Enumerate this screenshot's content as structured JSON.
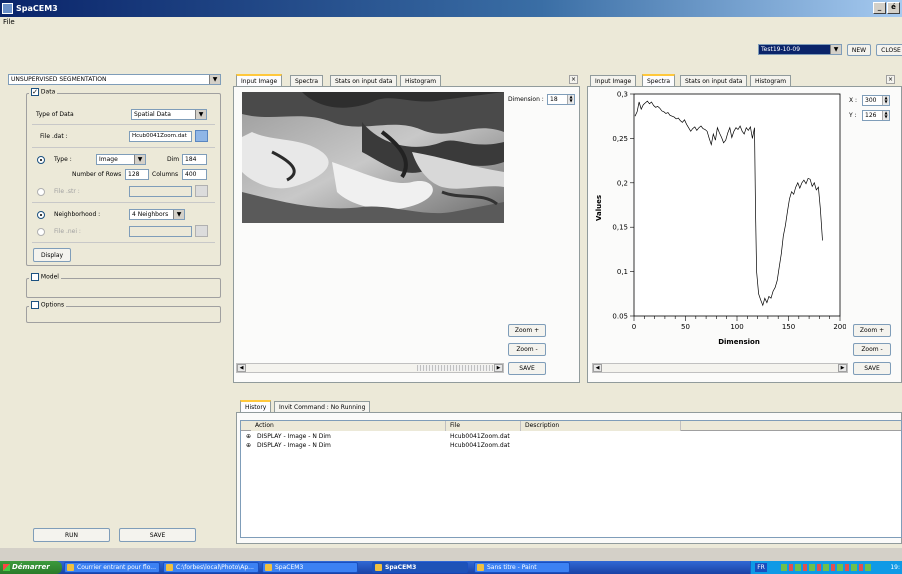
{
  "window": {
    "title": "SpaCEM3",
    "minimize": "_",
    "restore": "é"
  },
  "menu": {
    "file": "File"
  },
  "toolbar": {
    "session_value": "Test19-10-09",
    "new_label": "NEW",
    "close_label": "CLOSE"
  },
  "left": {
    "method_value": "UNSUPERVISED SEGMENTATION",
    "data_group": "Data",
    "type_of_data_label": "Type of Data",
    "type_of_data_value": "Spatial Data",
    "file_dat_label": "File .dat :",
    "file_dat_value": "Hcub0041Zoom.dat",
    "type_label": "Type :",
    "type_value": "Image",
    "dim_label": "Dim",
    "dim_value": "184",
    "rows_label": "Number of Rows",
    "rows_value": "128",
    "cols_label": "Columns",
    "cols_value": "400",
    "file_str_label": "File .str :",
    "neighborhood_label": "Neighborhood :",
    "neighborhood_value": "4 Neighbors",
    "file_nei_label": "File .nei :",
    "display_label": "Display",
    "model_group": "Model",
    "options_group": "Options",
    "run_label": "RUN",
    "save_label": "SAVE"
  },
  "left_view": {
    "tabs": [
      "Input Image",
      "Spectra",
      "Stats on input data",
      "Histogram"
    ],
    "dimension_label": "Dimension :",
    "dimension_value": "18",
    "zoom_in": "Zoom +",
    "zoom_out": "Zoom -",
    "save": "SAVE"
  },
  "right_view": {
    "tabs": [
      "Input Image",
      "Spectra",
      "Stats on input data",
      "Histogram"
    ],
    "x_label": "X :",
    "x_value": "300",
    "y_label": "Y :",
    "y_value": "126",
    "zoom_in": "Zoom +",
    "zoom_out": "Zoom -",
    "save": "SAVE"
  },
  "chart_data": {
    "type": "line",
    "xlabel": "Dimension",
    "ylabel": "Values",
    "xlim": [
      0,
      200
    ],
    "ylim": [
      0.05,
      0.3
    ],
    "x_ticks": [
      "0",
      "50",
      "100",
      "150",
      "200"
    ],
    "y_ticks": [
      "0,3",
      "0,25",
      "0,2",
      "0,15",
      "0,1",
      "0.05"
    ],
    "x": [
      1,
      3,
      5,
      7,
      9,
      11,
      13,
      15,
      17,
      19,
      21,
      23,
      25,
      27,
      29,
      31,
      33,
      35,
      37,
      39,
      41,
      43,
      45,
      47,
      49,
      51,
      53,
      55,
      57,
      59,
      61,
      63,
      65,
      67,
      69,
      71,
      73,
      75,
      77,
      79,
      81,
      83,
      85,
      87,
      89,
      91,
      93,
      95,
      97,
      99,
      101,
      103,
      105,
      107,
      109,
      111,
      113,
      115,
      117,
      118,
      119,
      121,
      123,
      125,
      127,
      129,
      131,
      133,
      135,
      137,
      139,
      141,
      143,
      145,
      147,
      149,
      151,
      153,
      155,
      157,
      159,
      161,
      163,
      165,
      167,
      169,
      171,
      173,
      175,
      177,
      179,
      181,
      183
    ],
    "y": [
      0.275,
      0.28,
      0.291,
      0.283,
      0.288,
      0.29,
      0.292,
      0.289,
      0.291,
      0.287,
      0.285,
      0.286,
      0.284,
      0.281,
      0.28,
      0.278,
      0.279,
      0.276,
      0.275,
      0.274,
      0.272,
      0.273,
      0.27,
      0.268,
      0.271,
      0.266,
      0.262,
      0.258,
      0.261,
      0.263,
      0.259,
      0.262,
      0.264,
      0.261,
      0.26,
      0.258,
      0.25,
      0.243,
      0.255,
      0.248,
      0.262,
      0.256,
      0.251,
      0.245,
      0.248,
      0.256,
      0.262,
      0.251,
      0.258,
      0.262,
      0.26,
      0.264,
      0.258,
      0.255,
      0.262,
      0.259,
      0.263,
      0.25,
      0.262,
      0.17,
      0.1,
      0.075,
      0.068,
      0.062,
      0.07,
      0.065,
      0.072,
      0.07,
      0.078,
      0.082,
      0.09,
      0.105,
      0.12,
      0.14,
      0.152,
      0.168,
      0.182,
      0.19,
      0.187,
      0.195,
      0.2,
      0.194,
      0.2,
      0.203,
      0.199,
      0.205,
      0.204,
      0.196,
      0.2,
      0.192,
      0.195,
      0.17,
      0.135
    ]
  },
  "history": {
    "tabs": [
      "History",
      "Invit Command : No Running"
    ],
    "columns": [
      "Action",
      "File",
      "Description"
    ],
    "rows": [
      {
        "action": "DISPLAY - Image - N Dim",
        "file": "Hcub0041Zoom.dat",
        "description": ""
      },
      {
        "action": "DISPLAY - Image - N Dim",
        "file": "Hcub0041Zoom.dat",
        "description": ""
      }
    ]
  },
  "taskbar": {
    "start": "Démarrer",
    "items": [
      "Courrier entrant pour flo...",
      "C:\\forbes\\local\\Photo\\Ap...",
      "SpaCEM3",
      "SpaCEM3",
      "Sans titre - Paint"
    ],
    "lang": "FR",
    "clock": "19:"
  }
}
